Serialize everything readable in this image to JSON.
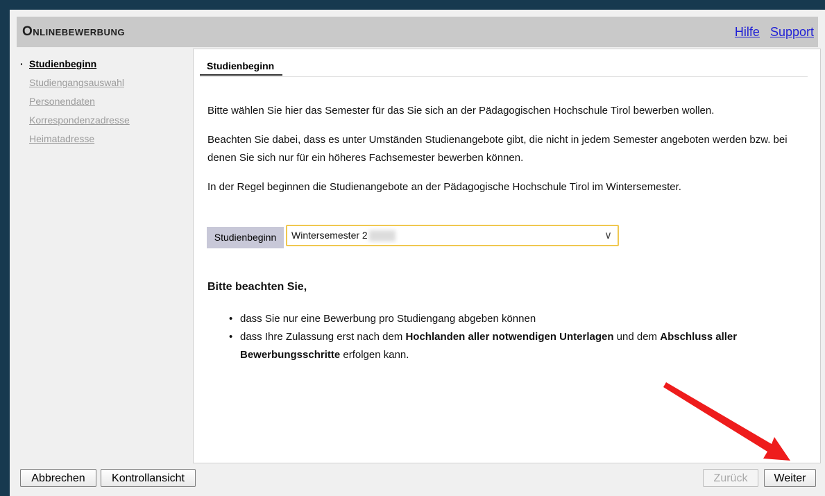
{
  "header": {
    "title": "Onlinebewerbung",
    "links": {
      "help": "Hilfe",
      "support": "Support"
    }
  },
  "sidebar": {
    "items": [
      {
        "label": "Studienbeginn",
        "state": "active"
      },
      {
        "label": "Studiengangsauswahl",
        "state": "disabled"
      },
      {
        "label": "Personendaten",
        "state": "disabled"
      },
      {
        "label": "Korrespondenzadresse",
        "state": "disabled"
      },
      {
        "label": "Heimatadresse",
        "state": "disabled"
      }
    ],
    "bullet": "·"
  },
  "main": {
    "tab": "Studienbeginn",
    "paragraphs": [
      "Bitte wählen Sie hier das Semester für das Sie sich an der Pädagogischen Hochschule Tirol bewerben wollen.",
      "Beachten Sie dabei, dass es unter Umständen Studienangebote gibt, die nicht in jedem Semester angeboten werden bzw. bei denen Sie sich nur für ein höheres Fachsemester bewerben können.",
      "In der Regel beginnen die Studienangebote an der Pädagogische Hochschule Tirol im Wintersemester."
    ],
    "field": {
      "label": "Studienbeginn",
      "selected_value": "Wintersemester 2"
    },
    "note_title": "Bitte beachten Sie,",
    "bullets": {
      "item1": "dass Sie nur eine Bewerbung pro Studiengang abgeben können",
      "item2_part1": "dass Ihre Zulassung erst nach dem ",
      "item2_bold1": "Hochlanden aller notwendigen Unterlagen",
      "item2_part2": " und dem ",
      "item2_bold2": "Abschluss aller Bewerbungsschritte",
      "item2_part3": " erfolgen kann."
    }
  },
  "footer": {
    "cancel": "Abbrechen",
    "control_view": "Kontrollansicht",
    "back": "Zurück",
    "next": "Weiter"
  },
  "colors": {
    "background": "#17394f",
    "header": "#c9c9c9",
    "link": "#1f1fd6",
    "select_border": "#f0c850",
    "annotation_arrow": "#ee1c1c"
  },
  "icons": {
    "select_chevron": "chevron-down-icon",
    "annotation": "red-arrow-icon"
  }
}
